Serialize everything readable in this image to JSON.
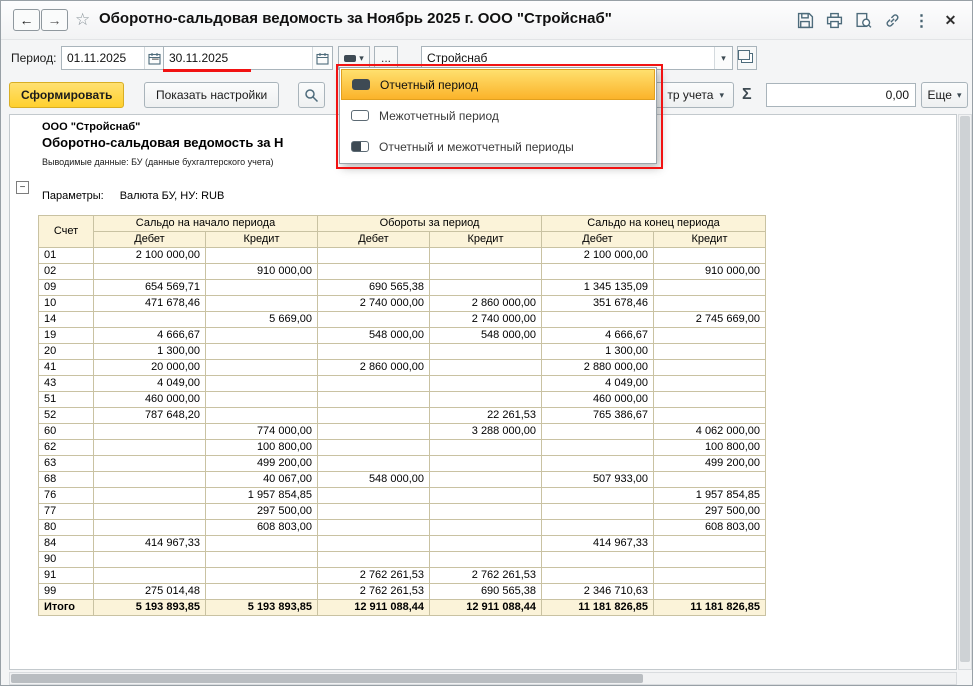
{
  "colors": {
    "accent_yellow": "#FFD02E",
    "selection_orange": "#FBB32A",
    "annotation_red": "#F11212",
    "table_header_bg": "#FBF3D9"
  },
  "icons": {
    "back": "←",
    "forward": "→",
    "star": "☆",
    "dots": "⋮",
    "close": "✕",
    "combo_arrow": "▾",
    "sigma": "Σ",
    "collapse_minus": "−",
    "dash": "–"
  },
  "titlebar": {
    "title": "Оборотно-сальдовая ведомость за Ноябрь 2025 г. ООО \"Стройснаб\""
  },
  "period_bar": {
    "label": "Период:",
    "date_from": "01.11.2025",
    "date_to": "30.11.2025",
    "ellipsis": "...",
    "organization": "Стройснаб"
  },
  "period_menu": {
    "items": [
      {
        "label": "Отчетный период",
        "selected": true,
        "icon_type": "filled",
        "icon_name": "report-period-icon"
      },
      {
        "label": "Межотчетный период",
        "selected": false,
        "icon_type": "outline",
        "icon_name": "interreport-period-icon"
      },
      {
        "label": "Отчетный и межотчетный периоды",
        "selected": false,
        "icon_type": "dual",
        "icon_name": "report-and-interreport-period-icon"
      }
    ]
  },
  "toolbar": {
    "generate": "Сформировать",
    "settings": "Показать настройки",
    "register_partial": "тр учета",
    "amount": "0,00",
    "more": "Еще"
  },
  "report": {
    "company": "ООО \"Стройснаб\"",
    "title_partial": "Оборотно-сальдовая ведомость за Н",
    "output_data": "Выводимые данные: БУ (данные бухгалтерского учета)",
    "params_label": "Параметры:",
    "params_value": "Валюта БУ, НУ: RUB"
  },
  "table": {
    "account_header": "Счет",
    "group_headers": [
      "Сальдо на начало периода",
      "Обороты за период",
      "Сальдо на конец периода"
    ],
    "sub_headers": [
      "Дебет",
      "Кредит"
    ],
    "rows": [
      {
        "account": "01",
        "cells": [
          "2 100 000,00",
          "",
          "",
          "",
          "2 100 000,00",
          ""
        ]
      },
      {
        "account": "02",
        "cells": [
          "",
          "910 000,00",
          "",
          "",
          "",
          "910 000,00"
        ]
      },
      {
        "account": "09",
        "cells": [
          "654 569,71",
          "",
          "690 565,38",
          "",
          "1 345 135,09",
          ""
        ]
      },
      {
        "account": "10",
        "cells": [
          "471 678,46",
          "",
          "2 740 000,00",
          "2 860 000,00",
          "351 678,46",
          ""
        ]
      },
      {
        "account": "14",
        "cells": [
          "",
          "5 669,00",
          "",
          "2 740 000,00",
          "",
          "2 745 669,00"
        ]
      },
      {
        "account": "19",
        "cells": [
          "4 666,67",
          "",
          "548 000,00",
          "548 000,00",
          "4 666,67",
          ""
        ]
      },
      {
        "account": "20",
        "cells": [
          "1 300,00",
          "",
          "",
          "",
          "1 300,00",
          ""
        ]
      },
      {
        "account": "41",
        "cells": [
          "20 000,00",
          "",
          "2 860 000,00",
          "",
          "2 880 000,00",
          ""
        ]
      },
      {
        "account": "43",
        "cells": [
          "4 049,00",
          "",
          "",
          "",
          "4 049,00",
          ""
        ]
      },
      {
        "account": "51",
        "cells": [
          "460 000,00",
          "",
          "",
          "",
          "460 000,00",
          ""
        ]
      },
      {
        "account": "52",
        "cells": [
          "787 648,20",
          "",
          "",
          "22 261,53",
          "765 386,67",
          ""
        ]
      },
      {
        "account": "60",
        "cells": [
          "",
          "774 000,00",
          "",
          "3 288 000,00",
          "",
          "4 062 000,00"
        ]
      },
      {
        "account": "62",
        "cells": [
          "",
          "100 800,00",
          "",
          "",
          "",
          "100 800,00"
        ]
      },
      {
        "account": "63",
        "cells": [
          "",
          "499 200,00",
          "",
          "",
          "",
          "499 200,00"
        ]
      },
      {
        "account": "68",
        "cells": [
          "",
          "40 067,00",
          "548 000,00",
          "",
          "507 933,00",
          ""
        ]
      },
      {
        "account": "76",
        "cells": [
          "",
          "1 957 854,85",
          "",
          "",
          "",
          "1 957 854,85"
        ]
      },
      {
        "account": "77",
        "cells": [
          "",
          "297 500,00",
          "",
          "",
          "",
          "297 500,00"
        ]
      },
      {
        "account": "80",
        "cells": [
          "",
          "608 803,00",
          "",
          "",
          "",
          "608 803,00"
        ]
      },
      {
        "account": "84",
        "cells": [
          "414 967,33",
          "",
          "",
          "",
          "414 967,33",
          ""
        ]
      },
      {
        "account": "90",
        "cells": [
          "",
          "",
          "",
          "",
          "",
          ""
        ]
      },
      {
        "account": "91",
        "cells": [
          "",
          "",
          "2 762 261,53",
          "2 762 261,53",
          "",
          ""
        ]
      },
      {
        "account": "99",
        "cells": [
          "275 014,48",
          "",
          "2 762 261,53",
          "690 565,38",
          "2 346 710,63",
          ""
        ]
      }
    ],
    "total": {
      "label": "Итого",
      "cells": [
        "5 193 893,85",
        "5 193 893,85",
        "12 911 088,44",
        "12 911 088,44",
        "11 181 826,85",
        "11 181 826,85"
      ]
    }
  }
}
